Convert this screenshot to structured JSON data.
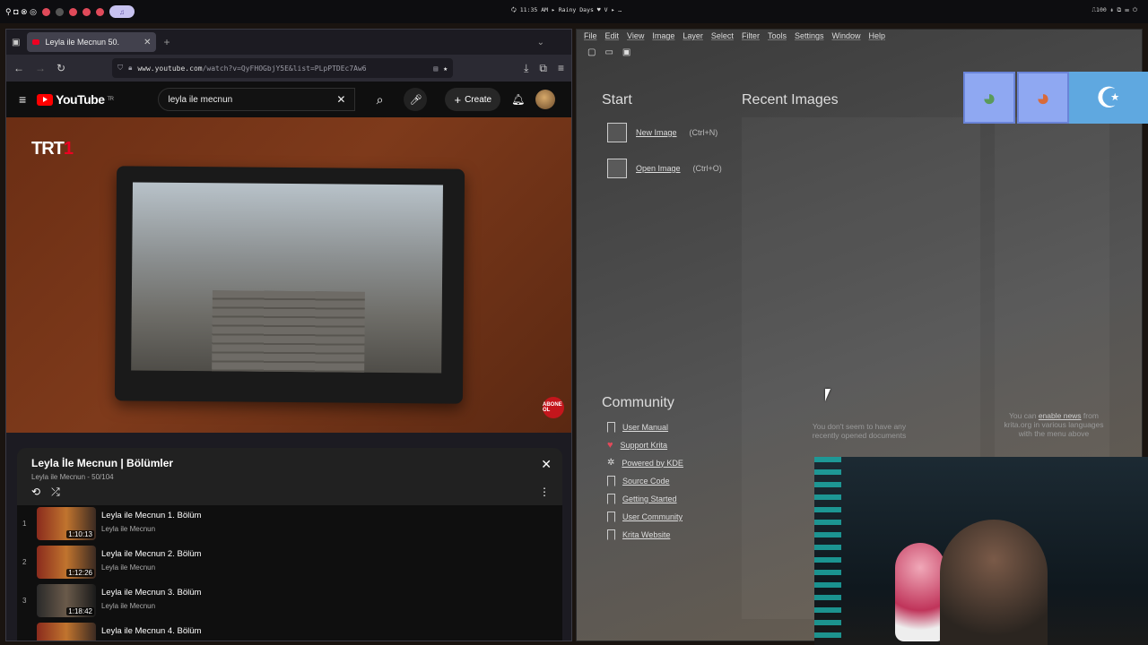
{
  "topbar": {
    "center_text": "🗘 11:35 AM ▸ Rainy Days ♥ V ▸ …",
    "right_text": "⎍100 ⇞   ⧉ ☰ ⏻"
  },
  "browser": {
    "tab_title": "Leyla ile Mecnun 50.",
    "url_host": "www.youtube.com",
    "url_path": "/watch?v=QyFHOGbjY5E&list=PLpPTDEc7Aw6",
    "youtube": {
      "logo_text": "YouTube",
      "logo_sup": "TR",
      "search_value": "leyla ile mecnun",
      "create_label": "Create"
    },
    "video": {
      "channel_logo_text": "TRT",
      "channel_logo_num": "1",
      "subscribe_badge": "ABONE OL"
    },
    "playlist": {
      "title": "Leyla İle Mecnun | Bölümler",
      "subtitle": "Leyla ile Mecnun - 50/104",
      "items": [
        {
          "index": "1",
          "title": "Leyla ile Mecnun 1. Bölüm",
          "channel": "Leyla ile Mecnun",
          "duration": "1:10:13"
        },
        {
          "index": "2",
          "title": "Leyla ile Mecnun 2. Bölüm",
          "channel": "Leyla ile Mecnun",
          "duration": "1:12:26"
        },
        {
          "index": "3",
          "title": "Leyla ile Mecnun 3. Bölüm",
          "channel": "Leyla ile Mecnun",
          "duration": "1:18:42"
        },
        {
          "index": "4",
          "title": "Leyla ile Mecnun 4. Bölüm",
          "channel": "",
          "duration": ""
        }
      ]
    }
  },
  "krita": {
    "menu": [
      "File",
      "Edit",
      "View",
      "Image",
      "Layer",
      "Select",
      "Filter",
      "Tools",
      "Settings",
      "Window",
      "Help"
    ],
    "start_heading": "Start",
    "recent_heading": "Recent Images",
    "new_image": "New Image",
    "new_image_shortcut": "(Ctrl+N)",
    "open_image": "Open Image",
    "open_image_shortcut": "(Ctrl+O)",
    "no_recent": "You don't seem to have any recently opened documents",
    "news_pre": "You can ",
    "news_link": "enable news",
    "news_post": " from krita.org in various languages with the menu above",
    "community_heading": "Community",
    "links": [
      "User Manual",
      "Support Krita",
      "Powered by KDE",
      "Source Code",
      "Getting Started",
      "User Community",
      "Krita Website"
    ]
  },
  "colors": {
    "youtube_red": "#ff0000",
    "krita_bg": "#4a4a4a",
    "playlist_bg": "#212121"
  }
}
